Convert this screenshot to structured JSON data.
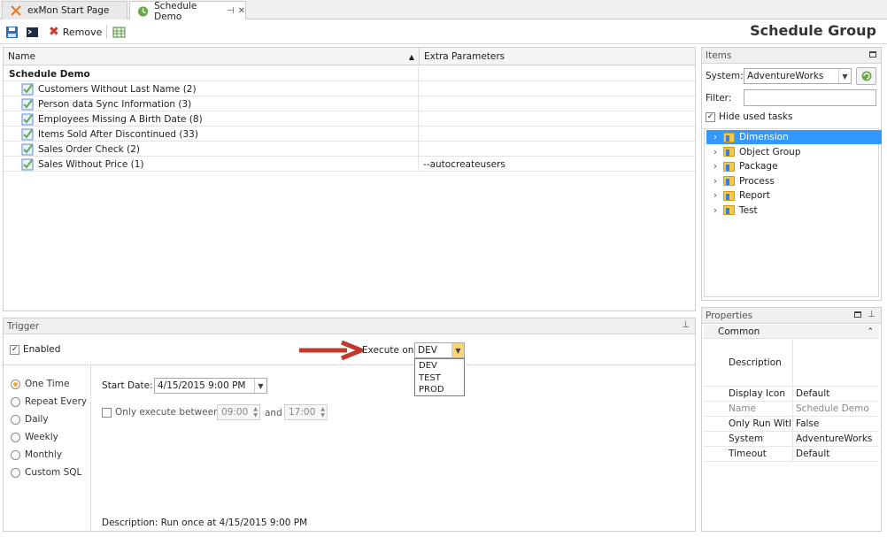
{
  "tabs": [
    {
      "label": "exMon Start Page"
    },
    {
      "label": "Schedule Demo"
    }
  ],
  "toolbar": {
    "remove_label": "Remove",
    "title": "Schedule Group"
  },
  "grid": {
    "columns": [
      "Name",
      "Extra Parameters"
    ],
    "group": "Schedule Demo",
    "rows": [
      {
        "name": "Customers Without Last Name (2)",
        "extra": ""
      },
      {
        "name": "Person data Sync Information (3)",
        "extra": ""
      },
      {
        "name": "Employees Missing A Birth Date (8)",
        "extra": ""
      },
      {
        "name": "Items Sold After Discontinued (33)",
        "extra": ""
      },
      {
        "name": "Sales Order Check (2)",
        "extra": ""
      },
      {
        "name": "Sales Without Price (1)",
        "extra": "--autocreateusers"
      }
    ]
  },
  "items": {
    "header": "Items",
    "system_label": "System:",
    "system_value": "AdventureWorks",
    "filter_label": "Filter:",
    "filter_value": "",
    "hide_used_label": "Hide used tasks",
    "tree": [
      "Dimension",
      "Object Group",
      "Package",
      "Process",
      "Report",
      "Test"
    ]
  },
  "properties": {
    "header": "Properties",
    "category": "Common",
    "rows": [
      {
        "name": "Description",
        "value": ""
      },
      {
        "name": "Display Icon",
        "value": "Default"
      },
      {
        "name": "Name",
        "value": "Schedule Demo"
      },
      {
        "name": "Only Run With I",
        "value": "False"
      },
      {
        "name": "System",
        "value": "AdventureWorks"
      },
      {
        "name": "Timeout",
        "value": "Default"
      }
    ]
  },
  "trigger": {
    "header": "Trigger",
    "enabled_label": "Enabled",
    "execute_label": "Execute on:",
    "execute_value": "DEV",
    "execute_options": [
      "DEV",
      "TEST",
      "PROD"
    ],
    "schedule_types": [
      "One Time",
      "Repeat Every",
      "Daily",
      "Weekly",
      "Monthly",
      "Custom SQL"
    ],
    "start_date_label": "Start Date:",
    "start_date_value": "4/15/2015 9:00 PM",
    "between_label": "Only execute between",
    "between_from": "09:00",
    "and_label": "and",
    "between_to": "17:00",
    "description": "Description:  Run once at 4/15/2015 9:00 PM"
  },
  "colors": {
    "selection": "#3399ff",
    "arrow": "#c0392b",
    "check": "#6aa84f"
  }
}
